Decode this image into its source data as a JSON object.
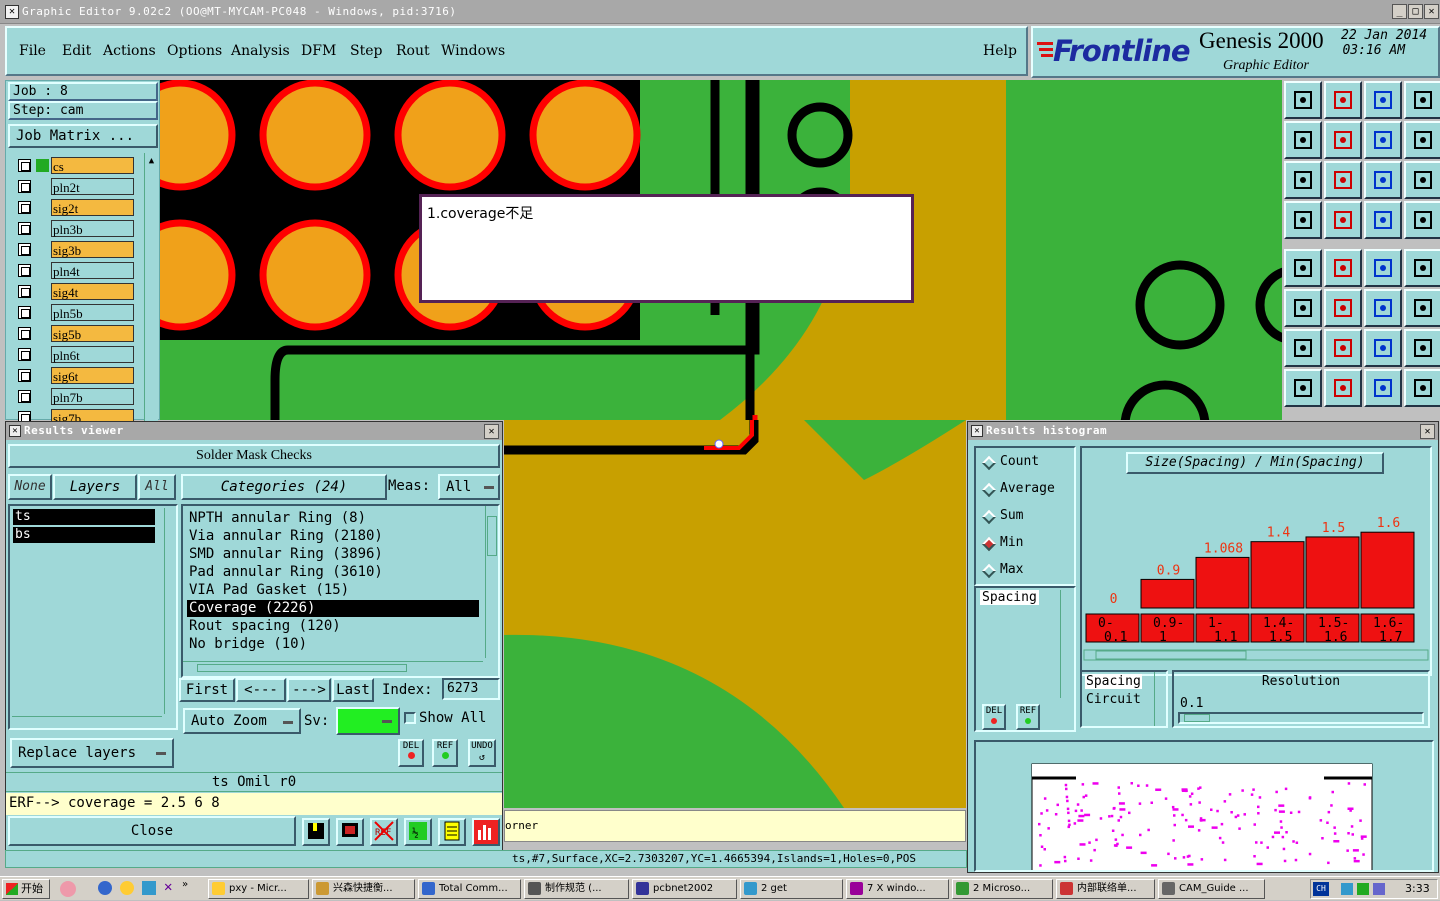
{
  "window": {
    "title": "Graphic Editor 9.02c2  (OO@MT-MYCAM-PC048 - Windows, pid:3716)"
  },
  "menu": {
    "items": [
      "File",
      "Edit",
      "Actions",
      "Options",
      "Analysis",
      "DFM",
      "Step",
      "Rout",
      "Windows"
    ],
    "help": "Help"
  },
  "brand": {
    "logo": "Frontline",
    "product": "Genesis 2000",
    "subtitle": "Graphic Editor",
    "date": "22 Jan 2014",
    "time": "03:16 AM"
  },
  "job": {
    "job": "Job  :  8",
    "step": "Step:  cam",
    "matrix_button": "Job Matrix ..."
  },
  "layers": [
    {
      "name": "cs",
      "color": "#f4b940",
      "active": true
    },
    {
      "name": "pln2t",
      "color": "#9fd8d8"
    },
    {
      "name": "sig2t",
      "color": "#f4b940"
    },
    {
      "name": "pln3b",
      "color": "#9fd8d8"
    },
    {
      "name": "sig3b",
      "color": "#f4b940"
    },
    {
      "name": "pln4t",
      "color": "#9fd8d8"
    },
    {
      "name": "sig4t",
      "color": "#f4b940"
    },
    {
      "name": "pln5b",
      "color": "#9fd8d8"
    },
    {
      "name": "sig5b",
      "color": "#f4b940"
    },
    {
      "name": "pln6t",
      "color": "#9fd8d8"
    },
    {
      "name": "sig6t",
      "color": "#f4b940"
    },
    {
      "name": "pln7b",
      "color": "#9fd8d8"
    },
    {
      "name": "sig7b",
      "color": "#f4b940"
    }
  ],
  "note": {
    "text": "1.coverage不足"
  },
  "results_viewer": {
    "title": "Results viewer",
    "header": "Solder Mask Checks",
    "none_btn": "None",
    "layers_btn": "Layers",
    "all_btn": "All",
    "categories_btn": "Categories (24)",
    "meas_label": "Meas:",
    "meas_value": "All",
    "layer_list": [
      "ts",
      "bs"
    ],
    "categories": [
      "NPTH annular Ring (8)",
      "Via annular Ring (2180)",
      "SMD annular Ring (3896)",
      "Pad annular Ring (3610)",
      "VIA Pad Gasket (15)",
      "Coverage (2226)",
      "Rout spacing (120)",
      "No bridge (10)"
    ],
    "selected_category": 5,
    "first": "First",
    "prev": "<---",
    "next": "--->",
    "last": "Last",
    "index_label": "Index:",
    "index_value": "6273",
    "auto_zoom": "Auto Zoom",
    "sv_label": "Sv:",
    "show_all": "Show All",
    "replace_layers": "Replace layers",
    "del": "DEL",
    "ref": "REF",
    "undo": "UNDO",
    "status": "ts Omil   r0",
    "erf": "ERF--> coverage = 2.5 6 8",
    "close": "Close"
  },
  "canvas_msg": {
    "left_fragment": "orner",
    "status": "ts,#7,Surface,XC=2.7303207,YC=1.4665394,Islands=1,Holes=0,POS"
  },
  "histogram": {
    "title": "Results histogram",
    "options": [
      "Count",
      "Average",
      "Sum",
      "Min",
      "Max"
    ],
    "selected_option": "Min",
    "chart_title": "Size(Spacing) / Min(Spacing)",
    "list": [
      "Spacing"
    ],
    "del": "DEL",
    "ref": "REF",
    "bottom_list": [
      "Spacing",
      "Circuit"
    ],
    "resolution_label": "Resolution",
    "resolution_value": "0.1"
  },
  "chart_data": {
    "type": "bar",
    "title": "Size(Spacing) / Min(Spacing)",
    "categories": [
      "0-0.1",
      "0.9-1",
      "1-1.1",
      "1.4-1.5",
      "1.5-1.6",
      "1.6-1.7"
    ],
    "values": [
      0,
      0.9,
      1.068,
      1.4,
      1.5,
      1.6
    ],
    "labels": [
      "0",
      "0.9",
      "1.068",
      "1.4",
      "1.5",
      "1.6"
    ],
    "ylim": [
      0,
      1.8
    ],
    "color": "#ee1111"
  },
  "taskbar": {
    "start": "开始",
    "items": [
      "pxy - Micr...",
      "兴森快捷衡...",
      "Total Comm...",
      "制作规范 (...",
      "pcbnet2002",
      "2 get",
      "7 X windo...",
      "2 Microso...",
      "内部联络单...",
      "CAM_Guide ..."
    ],
    "ch": "CH",
    "clock": "3:33"
  }
}
